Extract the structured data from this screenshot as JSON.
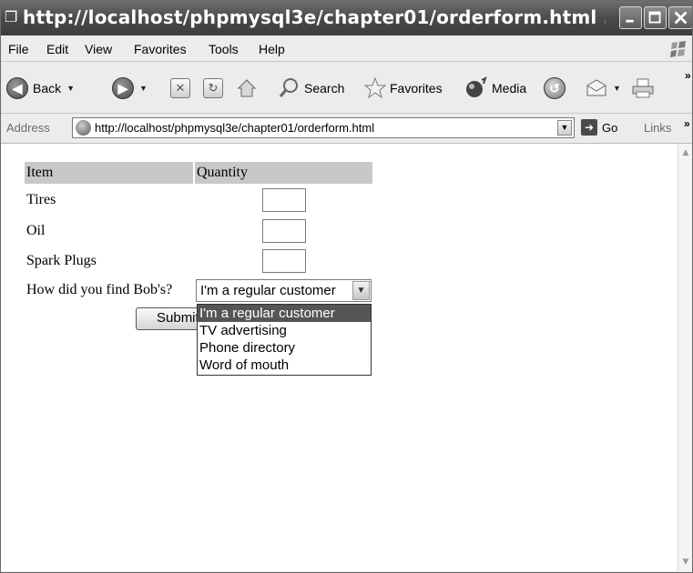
{
  "window": {
    "title": "http://localhost/phpmysql3e/chapter01/orderform.html ..."
  },
  "menu": {
    "items": [
      "File",
      "Edit",
      "View",
      "Favorites",
      "Tools",
      "Help"
    ]
  },
  "toolbar": {
    "back_label": "Back",
    "search_label": "Search",
    "favorites_label": "Favorites",
    "media_label": "Media"
  },
  "address": {
    "label": "Address",
    "url": "http://localhost/phpmysql3e/chapter01/orderform.html",
    "go_label": "Go",
    "links_label": "Links"
  },
  "form": {
    "header_item": "Item",
    "header_quantity": "Quantity",
    "rows": [
      "Tires",
      "Oil",
      "Spark Plugs"
    ],
    "find_label": "How did you find Bob's?",
    "select_value": "I'm a regular customer",
    "submit_label": "Submit Order",
    "options": [
      "I'm a regular customer",
      "TV advertising",
      "Phone directory",
      "Word of mouth"
    ],
    "selected_option_index": 0
  }
}
